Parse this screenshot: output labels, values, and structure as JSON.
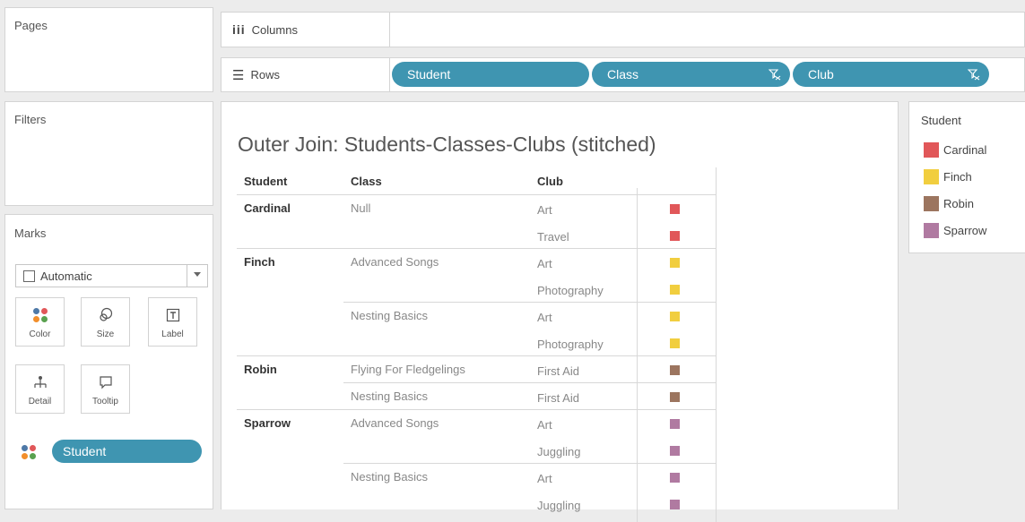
{
  "cards": {
    "pages": "Pages",
    "filters": "Filters",
    "marks": {
      "title": "Marks",
      "mark_type": "Automatic",
      "buttons": {
        "color": "Color",
        "size": "Size",
        "label": "Label",
        "detail": "Detail",
        "tooltip": "Tooltip"
      },
      "pill": "Student"
    }
  },
  "shelves": {
    "columns": "Columns",
    "rows": "Rows",
    "row_pills": [
      "Student",
      "Class",
      "Club"
    ]
  },
  "view": {
    "title": "Outer Join: Students-Classes-Clubs (stitched)",
    "headers": {
      "student": "Student",
      "class": "Class",
      "club": "Club"
    },
    "rows": [
      {
        "student": "Cardinal",
        "class": "Null",
        "club": "Art"
      },
      {
        "student": "",
        "class": "",
        "club": "Travel"
      },
      {
        "student": "Finch",
        "class": "Advanced Songs",
        "club": "Art"
      },
      {
        "student": "",
        "class": "",
        "club": "Photography"
      },
      {
        "student": "",
        "class": "Nesting Basics",
        "club": "Art"
      },
      {
        "student": "",
        "class": "",
        "club": "Photography"
      },
      {
        "student": "Robin",
        "class": "Flying For Fledgelings",
        "club": "First Aid"
      },
      {
        "student": "",
        "class": "Nesting Basics",
        "club": "First Aid"
      },
      {
        "student": "Sparrow",
        "class": "Advanced Songs",
        "club": "Art"
      },
      {
        "student": "",
        "class": "",
        "club": "Juggling"
      },
      {
        "student": "",
        "class": "Nesting Basics",
        "club": "Art"
      },
      {
        "student": "",
        "class": "",
        "club": "Juggling"
      }
    ]
  },
  "legend": {
    "title": "Student",
    "items": [
      {
        "label": "Cardinal",
        "color": "#e15759"
      },
      {
        "label": "Finch",
        "color": "#f1ce3f"
      },
      {
        "label": "Robin",
        "color": "#9c755f"
      },
      {
        "label": "Sparrow",
        "color": "#b07aa1"
      }
    ]
  },
  "colors": {
    "pill": "#3f95b1"
  },
  "icons": {
    "columns": "columns-icon",
    "rows": "rows-icon",
    "filter": "filter-icon",
    "color": "color-dots-icon",
    "size": "size-icon",
    "label": "label-icon",
    "detail": "detail-icon",
    "tooltip": "tooltip-icon"
  }
}
